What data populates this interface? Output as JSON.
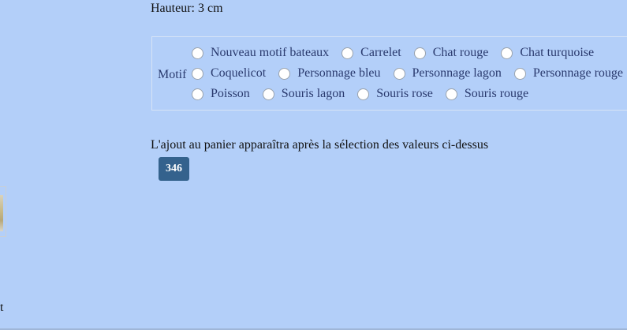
{
  "product": {
    "height_text": "Hauteur: 3 cm"
  },
  "motif": {
    "label": "Motif",
    "rows": [
      [
        "Nouveau motif bateaux",
        "Carrelet",
        "Chat rouge",
        "Chat turquoise"
      ],
      [
        "Coquelicot",
        "Personnage bleu",
        "Personnage lagon",
        "Personnage rouge"
      ],
      [
        "Poisson",
        "Souris lagon",
        "Souris rose",
        "Souris rouge"
      ]
    ],
    "selected": null
  },
  "cart": {
    "notice": "L'ajout au panier apparaîtra après la sélection des valeurs ci-dessus",
    "badge": "346"
  },
  "left_column": {
    "clipped_text": "t"
  },
  "colors": {
    "background": "#b3cff9",
    "badge_bg": "#34628d",
    "option_text": "#2a3a6e"
  }
}
